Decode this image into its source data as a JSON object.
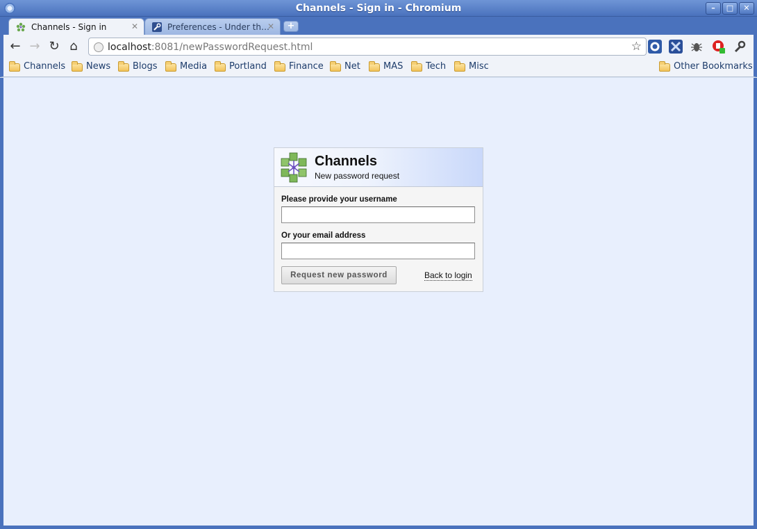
{
  "window": {
    "title": "Channels - Sign in - Chromium"
  },
  "tabs": [
    {
      "label": "Channels - Sign in",
      "active": true
    },
    {
      "label": "Preferences - Under th…",
      "active": false
    }
  ],
  "toolbar": {
    "url_host": "localhost",
    "url_rest": ":8081/newPasswordRequest.html"
  },
  "bookmarks": {
    "items": [
      "Channels",
      "News",
      "Blogs",
      "Media",
      "Portland",
      "Finance",
      "Net",
      "MAS",
      "Tech",
      "Misc"
    ],
    "other": "Other Bookmarks"
  },
  "panel": {
    "title": "Channels",
    "subtitle": "New password request",
    "username_label": "Please provide your username",
    "username_value": "",
    "email_label": "Or your email address",
    "email_value": "",
    "submit_label": "Request new password",
    "back_label": "Back to login"
  },
  "colors": {
    "frame": "#4a72bd",
    "page_bg": "#e8effd",
    "header_gradient_end": "#c9d8fa"
  }
}
